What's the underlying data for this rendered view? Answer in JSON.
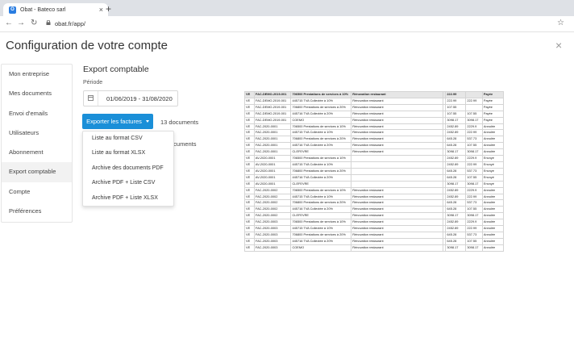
{
  "browser": {
    "tab_title": "Obat - Bateco sarl",
    "favicon_letter": "O",
    "close_tab_glyph": "×",
    "new_tab_glyph": "+",
    "back_glyph": "←",
    "forward_glyph": "→",
    "reload_glyph": "↻",
    "url": "obat.fr/app/",
    "star_glyph": "☆"
  },
  "page": {
    "title": "Configuration de votre compte",
    "close_glyph": "×"
  },
  "sidebar": {
    "items": [
      {
        "label": "Mon entreprise",
        "active": false
      },
      {
        "label": "Mes documents",
        "active": false
      },
      {
        "label": "Envoi d'emails",
        "active": false
      },
      {
        "label": "Utilisateurs",
        "active": false
      },
      {
        "label": "Abonnement",
        "active": false
      },
      {
        "label": "Export comptable",
        "active": true
      },
      {
        "label": "Compte",
        "active": false
      },
      {
        "label": "Préférences",
        "active": false
      }
    ]
  },
  "export": {
    "title": "Export comptable",
    "period_label": "Période",
    "date_range": "01/06/2019 - 31/08/2020",
    "button_label": "Exporter les factures",
    "doc_count": "13 documents",
    "doc_count_second": "ocuments",
    "menu": [
      "Liste au format CSV",
      "Liste au format XLSX",
      "Archive des documents PDF",
      "Archive PDF + Liste CSV",
      "Archive PDF + Liste XLSX"
    ]
  },
  "preview": {
    "header": [
      "VE",
      "FAC-DEMO-2019-001",
      "706500 Prestations de services à 10%",
      "Rénovation restaurant",
      "",
      "222.99",
      "",
      "Payée"
    ],
    "rows": [
      [
        "VE",
        "FAC-DEMO-2019-001",
        "445715 TVA Collectée à 10%",
        "Rénovation restaurant",
        "",
        "222.99",
        "222.99",
        "Payée"
      ],
      [
        "VE",
        "FAC-DEMO-2019-001",
        "706800 Prestations de services à 20%",
        "Rénovation restaurant",
        "",
        "107.55",
        "",
        "Payée"
      ],
      [
        "VE",
        "FAC-DEMO-2019-001",
        "445716 TVA Collectée à 20%",
        "Rénovation restaurant",
        "",
        "107.55",
        "107.55",
        "Payée"
      ],
      [
        "VE",
        "FAC-DEMO-2019-001",
        "COEMO",
        "Rénovation restaurant",
        "",
        "3098.17",
        "3098.17",
        "Payée"
      ],
      [
        "VE",
        "FAC-2020-0001",
        "706500 Prestations de services à 10%",
        "Rénovation restaurant",
        "",
        "2452.89",
        "2229.9",
        "Annulée"
      ],
      [
        "VE",
        "FAC-2020-0001",
        "445715 TVA Collectée à 10%",
        "Rénovation restaurant",
        "",
        "2452.89",
        "222.99",
        "Annulée"
      ],
      [
        "VE",
        "FAC-2020-0001",
        "706800 Prestations de services à 20%",
        "Rénovation restaurant",
        "",
        "645.28",
        "537.73",
        "Annulée"
      ],
      [
        "VE",
        "FAC-2020-0001",
        "445716 TVA Collectée à 20%",
        "Rénovation restaurant",
        "",
        "645.28",
        "107.55",
        "Annulée"
      ],
      [
        "VE",
        "FAC-2020-0001",
        "CLEFEVRE",
        "Rénovation restaurant",
        "",
        "3098.17",
        "3098.17",
        "Annulée"
      ],
      [
        "VE",
        "AV-2020-0001",
        "706500 Prestations de services à 10%",
        "",
        "",
        "2452.89",
        "2229.9",
        "Envoyé"
      ],
      [
        "VE",
        "AV-2020-0001",
        "445715 TVA Collectée à 10%",
        "",
        "",
        "2452.89",
        "222.99",
        "Envoyé"
      ],
      [
        "VE",
        "AV-2020-0001",
        "706800 Prestations de services à 20%",
        "",
        "",
        "645.28",
        "537.73",
        "Envoyé"
      ],
      [
        "VE",
        "AV-2020-0001",
        "445716 TVA Collectée à 20%",
        "",
        "",
        "645.28",
        "107.55",
        "Envoyé"
      ],
      [
        "VE",
        "AV-2020-0001",
        "CLEFEVRE",
        "",
        "",
        "3098.17",
        "3098.17",
        "Envoyé"
      ],
      [
        "VE",
        "FAC-2020-0002",
        "706500 Prestations de services à 10%",
        "Rénovation restaurant",
        "",
        "2452.89",
        "2229.9",
        "Annulée"
      ],
      [
        "VE",
        "FAC-2020-0002",
        "445715 TVA Collectée à 10%",
        "Rénovation restaurant",
        "",
        "2452.89",
        "222.99",
        "Annulée"
      ],
      [
        "VE",
        "FAC-2020-0002",
        "706800 Prestations de services à 20%",
        "Rénovation restaurant",
        "",
        "645.28",
        "537.73",
        "Annulée"
      ],
      [
        "VE",
        "FAC-2020-0002",
        "445716 TVA Collectée à 20%",
        "Rénovation restaurant",
        "",
        "645.28",
        "107.55",
        "Annulée"
      ],
      [
        "VE",
        "FAC-2020-0002",
        "CLEFEVRE",
        "Rénovation restaurant",
        "",
        "3098.17",
        "3098.17",
        "Annulée"
      ],
      [
        "VE",
        "FAC-2020-0003",
        "706500 Prestations de services à 10%",
        "Rénovation restaurant",
        "",
        "2452.89",
        "2229.9",
        "Annulée"
      ],
      [
        "VE",
        "FAC-2020-0003",
        "445715 TVA Collectée à 10%",
        "Rénovation restaurant",
        "",
        "2452.89",
        "222.99",
        "Annulée"
      ],
      [
        "VE",
        "FAC-2020-0003",
        "706800 Prestations de services à 20%",
        "Rénovation restaurant",
        "",
        "645.28",
        "537.73",
        "Annulée"
      ],
      [
        "VE",
        "FAC-2020-0003",
        "445716 TVA Collectée à 20%",
        "Rénovation restaurant",
        "",
        "645.28",
        "107.55",
        "Annulée"
      ],
      [
        "VE",
        "FAC-2020-0003",
        "COEMO",
        "Rénovation restaurant",
        "",
        "3098.17",
        "3098.17",
        "Annulée"
      ]
    ]
  }
}
